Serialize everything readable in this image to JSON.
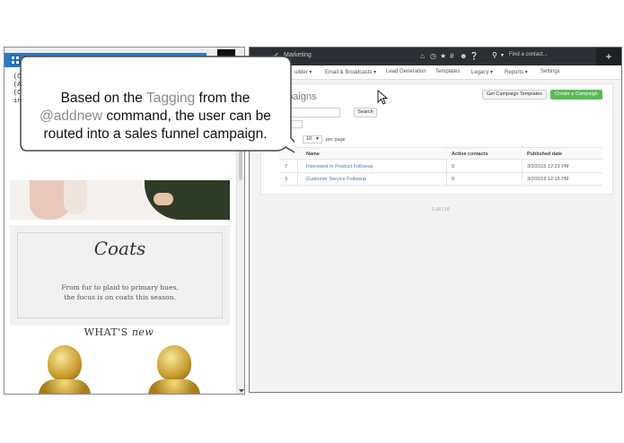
{
  "left_window": {
    "snippet_lines": [
      "(C",
      "(A",
      "(C",
      "in"
    ],
    "coats_title": "Coats",
    "coats_text_line1": "From fur to plaid to primary hues,",
    "coats_text_line2": "the focus is on coats this season.",
    "whats_label": "WHAT'S",
    "new_label": "new"
  },
  "app": {
    "brand": "Marketing",
    "search_placeholder": "Find a contact...",
    "plus_label": "+",
    "icons": [
      "home-icon",
      "clock-icon",
      "star-icon",
      "hashtag-icon",
      "person-icon",
      "help-icon",
      "search-icon"
    ],
    "nav": [
      "uilder",
      "Email & Broadcasts",
      "Lead Generation",
      "Templates",
      "Legacy",
      "Reports",
      "Settings"
    ],
    "page_title": "mpaigns",
    "search_button": "Search",
    "get_templates_button": "Get Campaign Templates",
    "create_campaign_button": "Create a Campaign",
    "per_page_value": "10",
    "per_page_label": "per page",
    "columns": [
      "Name",
      "Active contacts",
      "Published date"
    ],
    "rows": [
      {
        "id": "7",
        "name": "Interested In Product Followup",
        "active_contacts": "0",
        "published": "3/2/2015 12:23 PM"
      },
      {
        "id": "3",
        "name": "Customer Service Followup",
        "active_contacts": "0",
        "published": "3/2/2015 12:15 PM"
      }
    ],
    "pager": "1-16 | 16"
  },
  "callout": {
    "line1_prefix": "Based on the ",
    "line1_highlight": "Tagging",
    "line1_suffix": " from the",
    "line2_highlight": "@addnew",
    "line2_suffix": " command, the user can be",
    "line3": "routed into a sales funnel campaign."
  },
  "colors": {
    "callout_highlight": "#8c8c8c",
    "app_header": "#2b2f33",
    "create_button": "#5cb85c",
    "link": "#3a7bc8"
  }
}
